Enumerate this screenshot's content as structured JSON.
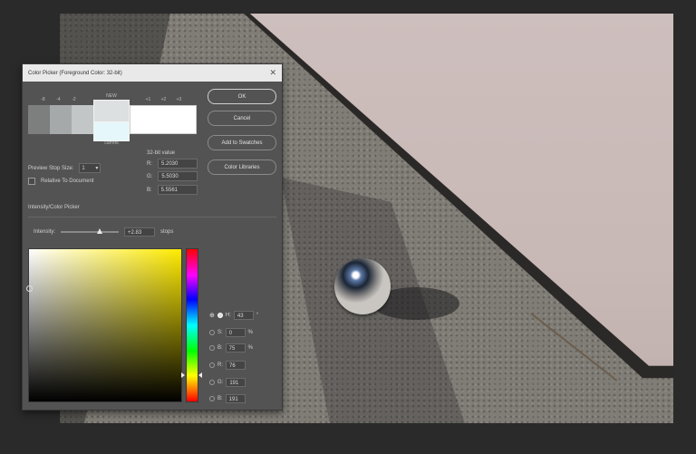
{
  "dialog": {
    "title": "Color Picker (Foreground Color: 32-bit)",
    "close_glyph": "✕",
    "stop_labels_left": [
      "-8",
      "-4",
      "-2"
    ],
    "stop_labels_right": [
      "+1",
      "+2",
      "+3"
    ],
    "selected_top_label": "NEW",
    "selected_bottom_label": "current",
    "swatch_colors": [
      "#7d7f7f",
      "#a6a9a9",
      "#c3c6c6"
    ],
    "preview_label": "Preview Stop Size:",
    "preview_value": "1",
    "relative_label": "Relative To Document",
    "value_header": "32-bit value",
    "r_label": "R:",
    "r_value": "5.2030",
    "g_label": "G:",
    "g_value": "5.5030",
    "b_label": "B:",
    "b_value": "5.5561",
    "section_label": "Intensity/Color Picker",
    "intensity_label": "Intensity:",
    "intensity_value": "+2.83",
    "intensity_unit": "stops"
  },
  "buttons": {
    "ok": "OK",
    "cancel": "Cancel",
    "add_swatches": "Add to Swatches",
    "color_libraries": "Color Libraries"
  },
  "components": [
    {
      "key": "H",
      "label": "H:",
      "value": "43",
      "unit": "°",
      "selected": true
    },
    {
      "key": "S",
      "label": "S:",
      "value": "0",
      "unit": "%",
      "selected": false
    },
    {
      "key": "B",
      "label": "B:",
      "value": "75",
      "unit": "%",
      "selected": false
    },
    {
      "key": "R",
      "label": "R:",
      "value": "76",
      "unit": "",
      "selected": false
    },
    {
      "key": "G",
      "label": "G:",
      "value": "191",
      "unit": "",
      "selected": false
    },
    {
      "key": "Bl",
      "label": "B:",
      "value": "191",
      "unit": "",
      "selected": false
    }
  ]
}
